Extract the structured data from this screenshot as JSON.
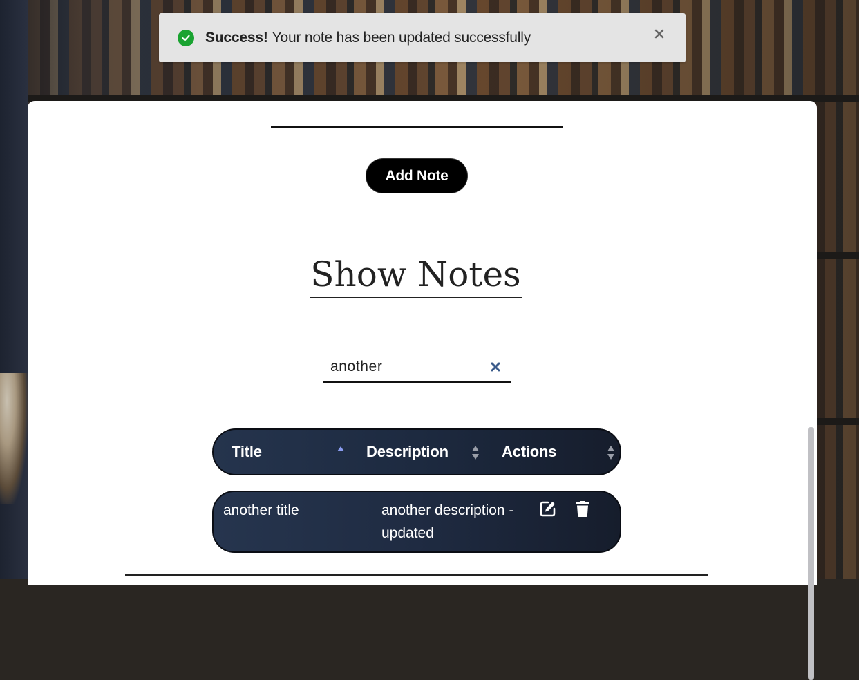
{
  "toast": {
    "status": "success",
    "title": "Success!",
    "message": "Your note has been updated successfully",
    "icon": "check-circle-icon",
    "close_icon": "close-icon",
    "color": "#1aa331"
  },
  "main": {
    "add_button_label": "Add Note",
    "heading": "Show Notes",
    "search": {
      "value": "another",
      "clear_icon": "close-icon",
      "clear_color": "#3a5a8a"
    },
    "table": {
      "columns": [
        {
          "label": "Title",
          "sort": "ascending"
        },
        {
          "label": "Description",
          "sort": "none"
        },
        {
          "label": "Actions",
          "sort": "none"
        }
      ],
      "rows": [
        {
          "title": "another title",
          "description": "another description - updated",
          "actions": [
            "edit-icon",
            "trash-icon"
          ]
        }
      ]
    },
    "accent": "#1c2a42"
  }
}
